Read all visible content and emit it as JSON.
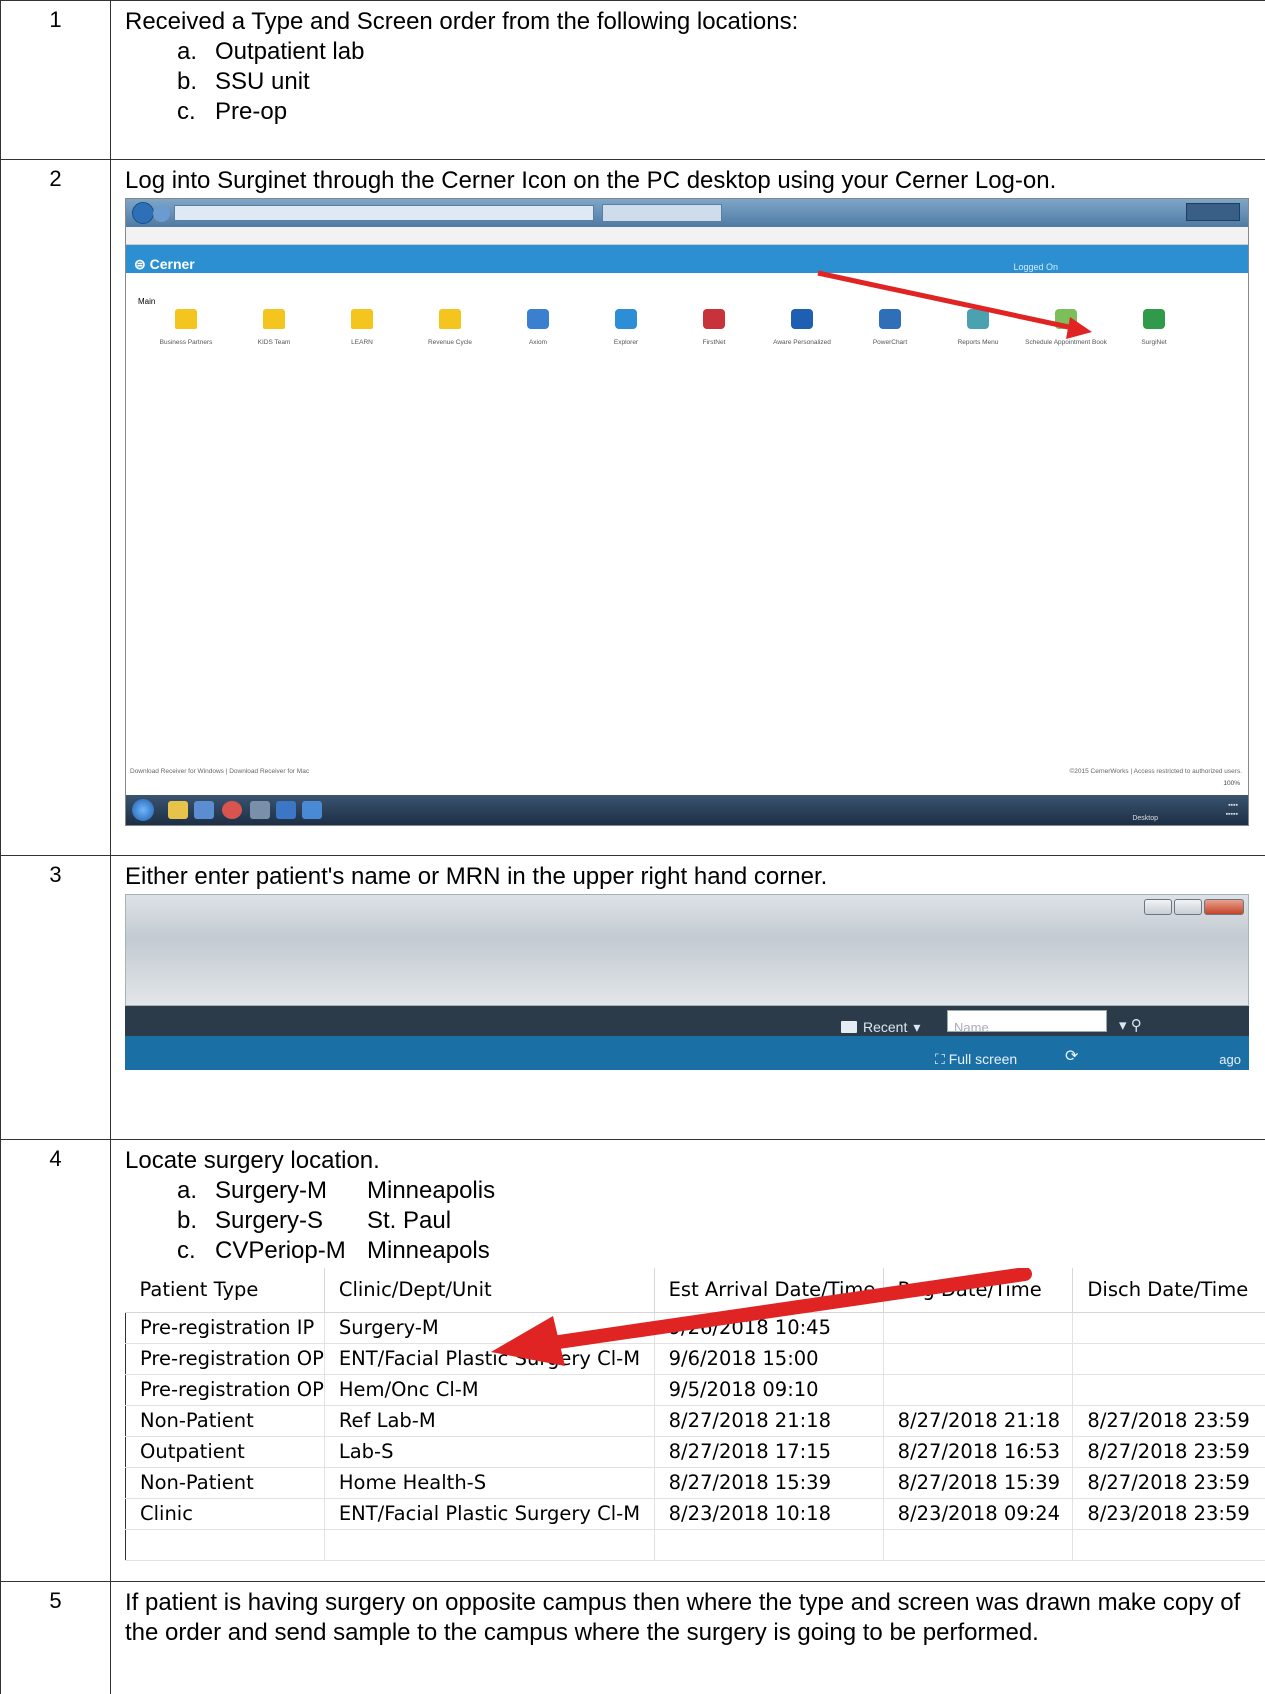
{
  "steps": [
    {
      "number": "1",
      "text": "Received a Type and Screen order from the following locations:",
      "items": [
        {
          "letter": "a.",
          "text": "Outpatient lab"
        },
        {
          "letter": "b.",
          "text": "SSU unit"
        },
        {
          "letter": "c.",
          "text": "Pre-op"
        }
      ]
    },
    {
      "number": "2",
      "text": "Log into Surginet through the Cerner Icon on the PC desktop using your Cerner Log-on."
    },
    {
      "number": "3",
      "text": "Either enter patient's name or MRN in the upper right hand corner."
    },
    {
      "number": "4",
      "text": "Locate surgery location.",
      "items": [
        {
          "letter": "a.",
          "name": "Surgery-M",
          "city": "Minneapolis"
        },
        {
          "letter": "b.",
          "name": "Surgery-S",
          "city": "St. Paul"
        },
        {
          "letter": "c.",
          "name": "CVPeriop-M",
          "city": "Minneapols"
        }
      ]
    },
    {
      "number": "5",
      "text": "If patient is having surgery on opposite campus then where the type and screen was drawn make copy of the order and send sample to the campus where the surgery is going to be performed."
    }
  ],
  "cerner_screen": {
    "brand": "Cerner",
    "logged_in": "Logged On",
    "section": "Main",
    "icons": [
      {
        "label": "Business Partners",
        "kind": "folder",
        "color": "#f4c41f"
      },
      {
        "label": "KIDS Team",
        "kind": "folder",
        "color": "#f4c41f"
      },
      {
        "label": "LEARN",
        "kind": "folder",
        "color": "#f4c41f"
      },
      {
        "label": "Revenue Cycle",
        "kind": "folder",
        "color": "#f4c41f"
      },
      {
        "label": "Axiom",
        "kind": "app",
        "color": "#3a7fd0"
      },
      {
        "label": "Explorer",
        "kind": "app",
        "color": "#2d8ed6"
      },
      {
        "label": "FirstNet",
        "kind": "app",
        "color": "#c8323a"
      },
      {
        "label": "Aware Personalized",
        "kind": "app",
        "color": "#1f5fb3"
      },
      {
        "label": "PowerChart",
        "kind": "app",
        "color": "#2f6fb7"
      },
      {
        "label": "Reports Menu",
        "kind": "app",
        "color": "#4aa1b0"
      },
      {
        "label": "Schedule Appointment Book",
        "kind": "app",
        "color": "#7cbf5a"
      },
      {
        "label": "SurgiNet",
        "kind": "app",
        "color": "#2f9b4a"
      }
    ],
    "footer_left": "Download Receiver for Windows | Download Receiver for Mac",
    "footer_right": "©2015 CernerWorks | Access restricted to authorized users.",
    "zoom": "100%",
    "taskbar_desktop": "Desktop",
    "accent": "#2c8fd1",
    "arrow_color": "#e02424"
  },
  "surginet_header": {
    "recent_label": "Recent",
    "name_placeholder": "Name",
    "full_screen_label": "Full screen",
    "ago_label": "ago"
  },
  "encounters": {
    "columns": [
      "Patient Type",
      "Clinic/Dept/Unit",
      "Est Arrival Date/Time",
      "Reg Date/Time",
      "Disch Date/Time"
    ],
    "rows": [
      [
        "Pre-registration IP",
        "Surgery-M",
        "9/26/2018 10:45",
        "",
        ""
      ],
      [
        "Pre-registration OP",
        "ENT/Facial Plastic Surgery Cl-M",
        "9/6/2018 15:00",
        "",
        ""
      ],
      [
        "Pre-registration OP",
        "Hem/Onc Cl-M",
        "9/5/2018 09:10",
        "",
        ""
      ],
      [
        "Non-Patient",
        "Ref Lab-M",
        "8/27/2018 21:18",
        "8/27/2018 21:18",
        "8/27/2018 23:59"
      ],
      [
        "Outpatient",
        "Lab-S",
        "8/27/2018 17:15",
        "8/27/2018 16:53",
        "8/27/2018 23:59"
      ],
      [
        "Non-Patient",
        "Home Health-S",
        "8/27/2018 15:39",
        "8/27/2018 15:39",
        "8/27/2018 23:59"
      ],
      [
        "Clinic",
        "ENT/Facial Plastic Surgery Cl-M",
        "8/23/2018 10:18",
        "8/23/2018 09:24",
        "8/23/2018 23:59"
      ],
      [
        "",
        "",
        "",
        "",
        ""
      ]
    ]
  }
}
